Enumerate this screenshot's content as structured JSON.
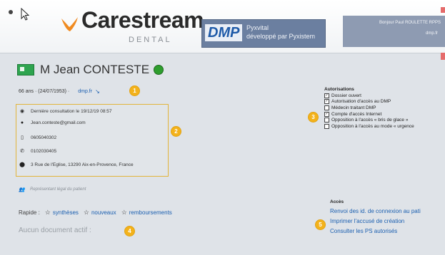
{
  "colors": {
    "accent": "#f3b21b",
    "link": "#1b5fb0",
    "header_blue": "#6b7fa0",
    "status_green": "#2e9e2e"
  },
  "header": {
    "brand": "Carestream",
    "brand_sub": "DENTAL",
    "dmp_logo": "DMP",
    "dmp_line1": "Pyxvital",
    "dmp_line2": "développé par Pyxistem",
    "user": "Bonjour Paul ROULETTE RPPS",
    "user_link": "dmp.fr"
  },
  "patient": {
    "name": "M Jean CONTESTE",
    "age_dob": "66 ans · (24/07/1953) ·",
    "dmp_link": "dmp.fr",
    "last_visit": "Dernière consultation le 19/12/19 08:57",
    "email": "Jean.conteste@gmail.com",
    "mobile": "0605040302",
    "phone": "0102030405",
    "address": "3 Rue de l'Eglise, 13290 Aix-en-Provence, France",
    "legal_rep": "Représentant légal du patient"
  },
  "badges": {
    "b1": "1",
    "b2": "2",
    "b3": "3",
    "b4": "4",
    "b5": "5"
  },
  "quick": {
    "label": "Rapide :",
    "items": [
      "synthèses",
      "nouveaux",
      "remboursements"
    ]
  },
  "no_document": "Aucun document actif :",
  "authorizations": {
    "title": "Autorisations",
    "items": [
      {
        "label": "Dossier ouvert",
        "checked": true
      },
      {
        "label": "Autorisation d'accès au DMP",
        "checked": true
      },
      {
        "label": "Médecin traitant DMP",
        "checked": false
      },
      {
        "label": "Compte d'accès Internet",
        "checked": true
      },
      {
        "label": "Opposition à l'accès « bris de glace »",
        "checked": false
      },
      {
        "label": "Opposition à l'accès au mode « urgence",
        "checked": false
      }
    ]
  },
  "access": {
    "title": "Accès",
    "links": [
      "Renvoi des id. de connexion au pati",
      "Imprimer l'accusé de création",
      "Consulter les PS autorisés"
    ]
  },
  "icons": {
    "gear": "gear-icon",
    "cursor": "cursor-icon",
    "eye": "eye-icon",
    "email": "email-icon",
    "mobile": "mobile-icon",
    "phone": "phone-icon",
    "pin": "location-icon",
    "people": "people-icon",
    "star": "star-icon",
    "card": "patient-card-icon",
    "status": "status-dot-icon"
  }
}
